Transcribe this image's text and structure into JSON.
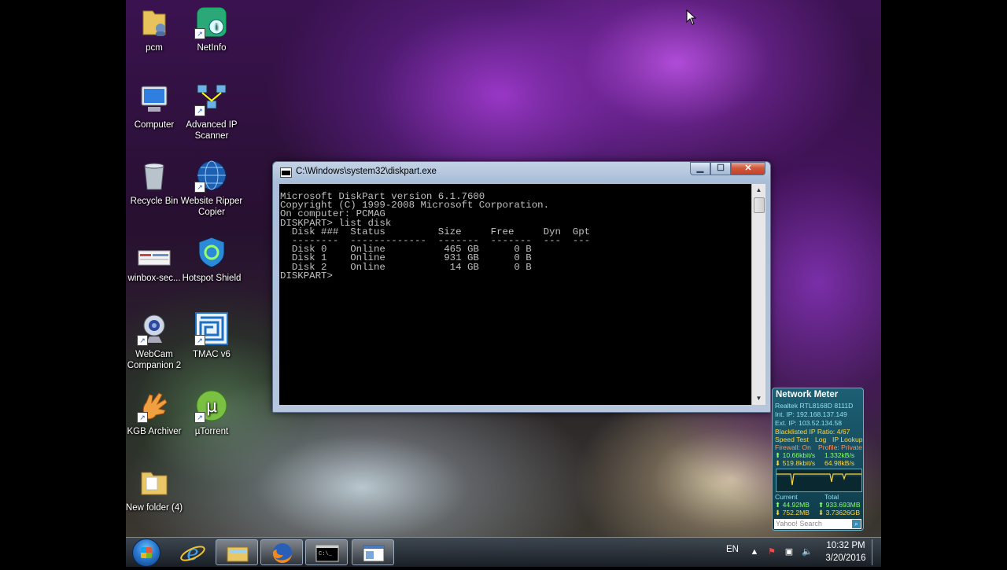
{
  "desktop": {
    "icons": [
      {
        "label": "pcm",
        "icon": "user-folder-icon"
      },
      {
        "label": "NetInfo",
        "icon": "netinfo-icon"
      },
      {
        "label": "Computer",
        "icon": "computer-icon"
      },
      {
        "label": "Advanced IP Scanner",
        "icon": "network-scanner-icon"
      },
      {
        "label": "Recycle Bin",
        "icon": "recycle-bin-icon"
      },
      {
        "label": "Website Ripper Copier",
        "icon": "globe-icon"
      },
      {
        "label": "winbox-sec...",
        "icon": "file-icon"
      },
      {
        "label": "Hotspot Shield",
        "icon": "shield-icon"
      },
      {
        "label": "WebCam Companion 2",
        "icon": "webcam-icon"
      },
      {
        "label": "TMAC v6",
        "icon": "maze-icon"
      },
      {
        "label": "KGB Archiver",
        "icon": "hand-icon"
      },
      {
        "label": "µTorrent",
        "icon": "utorrent-icon"
      },
      {
        "label": "New folder (4)",
        "icon": "folder-icon"
      }
    ]
  },
  "console": {
    "title": "C:\\Windows\\system32\\diskpart.exe",
    "lines": [
      "Microsoft DiskPart version 6.1.7600",
      "Copyright (C) 1999-2008 Microsoft Corporation.",
      "On computer: PCMAG",
      "",
      "DISKPART> list disk",
      "",
      "  Disk ###  Status         Size     Free     Dyn  Gpt",
      "  --------  -------------  -------  -------  ---  ---",
      "  Disk 0    Online          465 GB      0 B",
      "  Disk 1    Online          931 GB      0 B",
      "  Disk 2    Online           14 GB      0 B",
      "",
      "DISKPART> "
    ]
  },
  "network_meter": {
    "title": "Network Meter",
    "adapter": "Realtek RTL8168D 8111D",
    "int_ip": "Int. IP: 192.168.137.149",
    "ext_ip": "Ext. IP: 103.52.134.58",
    "blacklist": "Blacklisted IP Ratio: 4/67",
    "links": [
      "Speed Test",
      "Log",
      "IP Lookup"
    ],
    "firewall": "Firewall: On",
    "profile": "Profile: Private",
    "up_rate": "10.66kbit/s",
    "up_rate2": "1.332kB/s",
    "down_rate": "519.8kbit/s",
    "down_rate2": "64.98kB/s",
    "current_label": "Current",
    "total_label": "Total",
    "cur_up": "44.92MB",
    "tot_up": "933.693MB",
    "cur_down": "752.2MB",
    "tot_down": "3.73626GB",
    "search_placeholder": "Yahoo! Search"
  },
  "taskbar": {
    "language": "EN",
    "time": "10:32 PM",
    "date": "3/20/2016",
    "buttons": [
      "start-button",
      "internet-explorer-icon",
      "explorer-icon",
      "firefox-icon",
      "cmd-icon",
      "diskpart-window-icon"
    ]
  }
}
